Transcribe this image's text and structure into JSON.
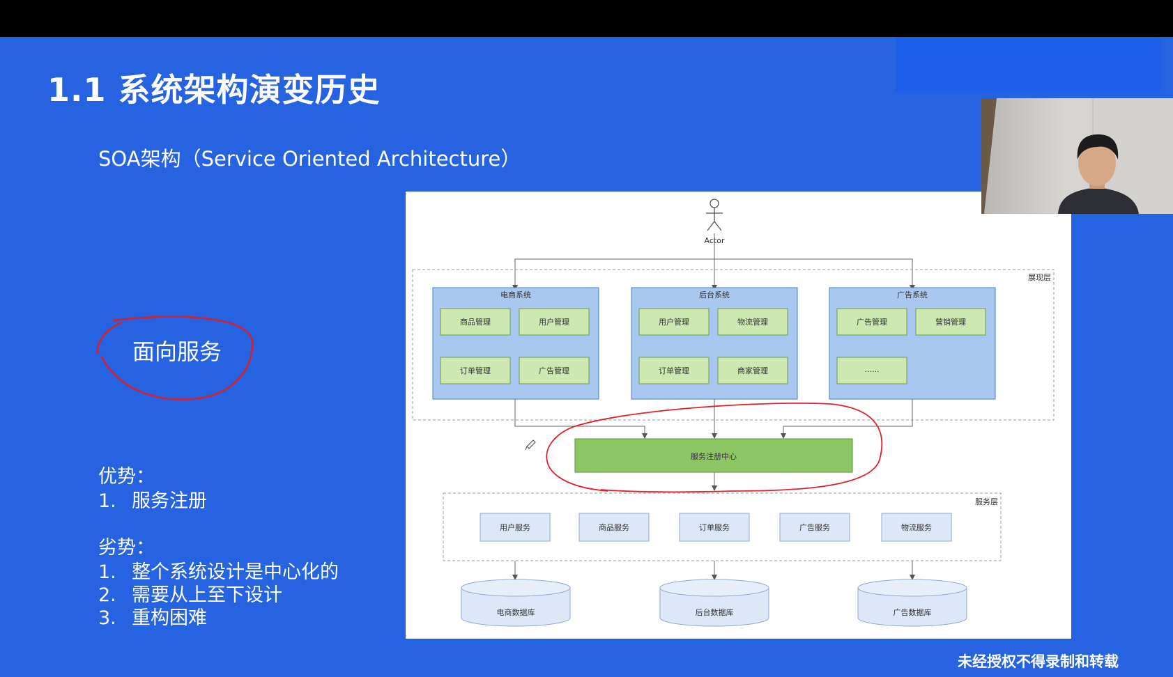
{
  "slide": {
    "title": "1.1 系统架构演变历史",
    "subtitle": "SOA架构（Service Oriented Architecture）",
    "highlight": "面向服务",
    "advantages": {
      "heading": "优势：",
      "items": [
        {
          "num": "1.",
          "text": "服务注册"
        }
      ]
    },
    "disadvantages": {
      "heading": "劣势：",
      "items": [
        {
          "num": "1.",
          "text": "整个系统设计是中心化的"
        },
        {
          "num": "2.",
          "text": "需要从上至下设计"
        },
        {
          "num": "3.",
          "text": "重构困难"
        }
      ]
    },
    "watermark": "未经授权不得录制和转载"
  },
  "diagram": {
    "actor": "Actor",
    "presentation_layer": "展现层",
    "service_layer": "服务层",
    "systems": [
      {
        "name": "电商系统",
        "modules": [
          "商品管理",
          "用户管理",
          "订单管理",
          "广告管理"
        ]
      },
      {
        "name": "后台系统",
        "modules": [
          "用户管理",
          "物流管理",
          "订单管理",
          "商家管理"
        ]
      },
      {
        "name": "广告系统",
        "modules": [
          "广告管理",
          "营销管理",
          "......"
        ]
      }
    ],
    "registry": "服务注册中心",
    "services": [
      "用户服务",
      "商品服务",
      "订单服务",
      "广告服务",
      "物流服务"
    ],
    "databases": [
      "电商数据库",
      "后台数据库",
      "广告数据库"
    ]
  },
  "colors": {
    "slide_bg": "#2563e0",
    "system_box": "#a8c8f0",
    "module_box": "#cde8b0",
    "registry_box": "#8cc665",
    "service_box": "#dde7f7",
    "annotation_red": "#e0202a"
  }
}
